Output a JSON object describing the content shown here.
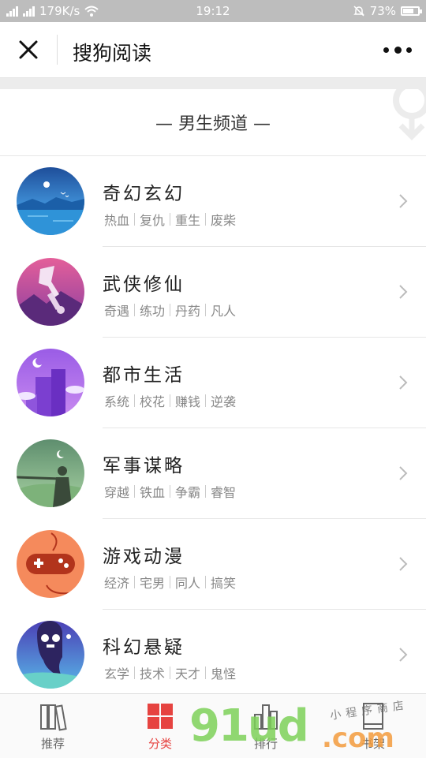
{
  "status_bar": {
    "network": "2G 4G",
    "speed": "179K/s",
    "time": "19:12",
    "battery_percent": "73%",
    "battery_level": 0.73
  },
  "title_bar": {
    "title": "搜狗阅读"
  },
  "channel": {
    "label": "— 男生频道 —"
  },
  "categories": [
    {
      "name": "奇幻玄幻",
      "tags": [
        "热血",
        "复仇",
        "重生",
        "废柴"
      ],
      "icon": "moon-lake-icon"
    },
    {
      "name": "武侠修仙",
      "tags": [
        "奇遇",
        "练功",
        "丹药",
        "凡人"
      ],
      "icon": "sword-icon"
    },
    {
      "name": "都市生活",
      "tags": [
        "系统",
        "校花",
        "赚钱",
        "逆袭"
      ],
      "icon": "city-building-icon"
    },
    {
      "name": "军事谋略",
      "tags": [
        "穿越",
        "铁血",
        "争霸",
        "睿智"
      ],
      "icon": "soldier-rifle-icon"
    },
    {
      "name": "游戏动漫",
      "tags": [
        "经济",
        "宅男",
        "同人",
        "搞笑"
      ],
      "icon": "gamepad-icon"
    },
    {
      "name": "科幻悬疑",
      "tags": [
        "玄学",
        "技术",
        "天才",
        "鬼怪"
      ],
      "icon": "ghost-icon"
    }
  ],
  "tabs": [
    {
      "label": "推荐",
      "icon": "books-icon",
      "active": false
    },
    {
      "label": "分类",
      "icon": "grid-icon",
      "active": true
    },
    {
      "label": "排行",
      "icon": "ranking-icon",
      "active": false
    },
    {
      "label": "书架",
      "icon": "bookshelf-icon",
      "active": false
    }
  ],
  "watermark": {
    "main": "91ud",
    "suffix": ".com",
    "handwriting": "小程序商店"
  },
  "colors": {
    "accent": "#e64340",
    "status_bar": "#bdbdbd"
  }
}
